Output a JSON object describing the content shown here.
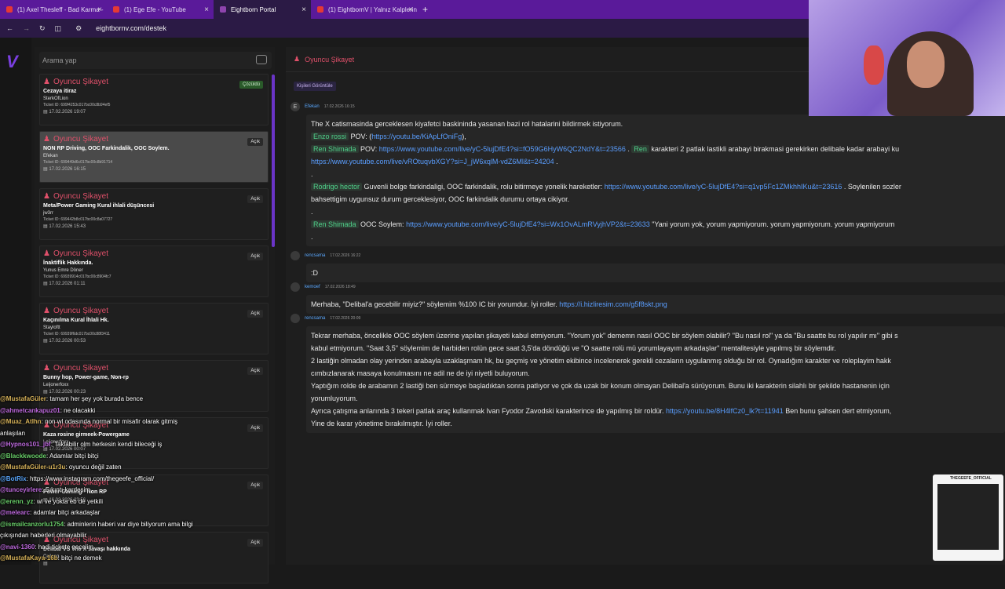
{
  "tabs": [
    {
      "label": "(1) Axel Thesleff - Bad Karma -",
      "color": "#e53935"
    },
    {
      "label": "(1) Ege Efe - YouTube",
      "color": "#e53935"
    },
    {
      "label": "Eightborn Portal",
      "color": "#8e44ad"
    },
    {
      "label": "(1) EightbornV | Yalnız Kalplerin",
      "color": "#e53935"
    }
  ],
  "newtab": "+",
  "url": "eightbornv.com/destek",
  "sidebar": {
    "search_placeholder": "Arama yap",
    "tickets": [
      {
        "title": "Oyuncu Şikayet",
        "subject": "Cezaya itiraz",
        "user": "SterkOfLion",
        "tid": "Ticket ID: 699f4253c017bc00c8b94ef5",
        "date": "17.02.2026 19:07",
        "status": "Çözüldü"
      },
      {
        "title": "Oyuncu Şikayet",
        "subject": "NON RP Driving, OOC Farkindalik, OOC Soylem.",
        "user": "Efekan",
        "tid": "Ticket ID: 699449d6c017bc00c8b91714",
        "date": "17.02.2026 16:15",
        "status": "Açık"
      },
      {
        "title": "Oyuncu Şikayet",
        "subject": "Meta/Power Gaming Kural ihlali düşüncesi",
        "user": "jw3rr",
        "tid": "Ticket ID: 699442b8c017bc00c8a07727",
        "date": "17.02.2026 15:43",
        "status": "Açık"
      },
      {
        "title": "Oyuncu Şikayet",
        "subject": "İnaktiflik Hakkında.",
        "user": "Yunus Emre Döner",
        "tid": "Ticket ID: 69939914c017bc00c8904fc7",
        "date": "17.02.2026 01:11",
        "status": "Açık"
      },
      {
        "title": "Oyuncu Şikayet",
        "subject": "Kaçınılma Kural İhlali Hk.",
        "user": "Stayloftt",
        "tid": "Ticket ID: 69939f6dc017bc00c88f3411",
        "date": "17.02.2026 00:53",
        "status": "Açık"
      },
      {
        "title": "Oyuncu Şikayet",
        "subject": "Bunny hop, Power-game, Non-rp",
        "user": "Leijonerfoxx",
        "tid": "",
        "date": "17.02.2026 00:23",
        "status": "Açık"
      },
      {
        "title": "Oyuncu Şikayet",
        "subject": "Kaza rosine girmeek-Powergame",
        "user": "Leijonerfoxx",
        "tid": "",
        "date": "17.02.2026 00:07",
        "status": "Açık"
      },
      {
        "title": "Oyuncu Şikayet",
        "subject": "Power-Gaming - Non RP",
        "user": "",
        "tid": "",
        "date": "16.02.2026 23:56",
        "status": "Açık"
      },
      {
        "title": "Oyuncu Şikayet",
        "subject": "Delibal VS The X savaşı hakkında",
        "user": "Ceileng",
        "tid": "",
        "date": "",
        "status": "Açık"
      }
    ]
  },
  "main": {
    "header": "Oyuncu Şikayet",
    "view_button": "Kişileri Görüntüle",
    "messages": [
      {
        "user": "Efekan",
        "date": "17.02.2026 16:15",
        "avatar": "E",
        "lines": [
          [
            {
              "t": "The X catismasinda gerceklesen kiyafetci baskininda yasanan bazi rol hatalarini bildirmek istiyorum."
            }
          ],
          [
            {
              "t": "Enzo rossi",
              "k": "tag"
            },
            {
              "t": " POV: ("
            },
            {
              "t": "https://youtu.be/KiApLfOniFg",
              "k": "link"
            },
            {
              "t": "),"
            }
          ],
          [
            {
              "t": "Ren Shimada",
              "k": "tag"
            },
            {
              "t": " POV: "
            },
            {
              "t": "https://www.youtube.com/live/yC-5lujDfE4?si=fO59G6HyW6QC2NdY&t=23566",
              "k": "link"
            },
            {
              "t": " . "
            },
            {
              "t": "Ren",
              "k": "tag"
            },
            {
              "t": " karakteri 2 patlak lastikli arabayi birakmasi gerekirken delibale kadar arabayi ku"
            }
          ],
          [
            {
              "t": "https://www.youtube.com/live/vROtuqvbXGY?si=J_jW6xqlM-vdZ6Ml&t=24204",
              "k": "link"
            },
            {
              "t": " ."
            }
          ],
          [
            {
              "t": "."
            }
          ],
          [
            {
              "t": "Rodrigo hector",
              "k": "tag"
            },
            {
              "t": " Guvenli bolge farkindaligi, OOC farkindalik, rolu bitirmeye yonelik hareketler: "
            },
            {
              "t": "https://www.youtube.com/live/yC-5lujDfE4?si=q1vp5Fc1ZMkhhIKu&t=23616",
              "k": "link"
            },
            {
              "t": " . Soylenilen sozler"
            }
          ],
          [
            {
              "t": "bahsettigim uygunsuz durum gerceklesiyor, OOC farkindalik durumu ortaya cikiyor."
            }
          ],
          [
            {
              "t": "."
            }
          ],
          [
            {
              "t": "Ren Shimada",
              "k": "tag"
            },
            {
              "t": " OOC Soylem: "
            },
            {
              "t": "https://www.youtube.com/live/yC-5lujDfE4?si=Wx1OvALmRVyjhVP2&t=23633",
              "k": "link"
            },
            {
              "t": " \"Yani yorum yok, yorum yapmiyorum. yorum yapmiyorum. yorum yapmiyorum"
            }
          ],
          [
            {
              "t": "."
            }
          ]
        ]
      },
      {
        "user": "rencsama",
        "date": "17.02.2026 16:22",
        "avatar": "",
        "lines": [
          [
            {
              "t": ":D"
            }
          ]
        ]
      },
      {
        "user": "kemoef",
        "date": "17.02.2026 18:49",
        "avatar": "",
        "lines": [
          [
            {
              "t": "Merhaba, \"Delibal'a gecebilir miyiz?\" söylemim %100 IC bir yorumdur. İyi roller. "
            },
            {
              "t": "https://i.hizliresim.com/g5f8skt.png",
              "k": "link"
            }
          ]
        ]
      },
      {
        "user": "rencsama",
        "date": "17.02.2026 20:09",
        "avatar": "",
        "lines": [
          [
            {
              "t": "Tekrar merhaba, öncelikle OOC söylem üzerine yapılan şikayeti kabul etmiyorum. \"Yorum yok\" dememn nasıl OOC bir söylem olabilir? \"Bu nasıl rol\" ya da \"Bu saatte bu rol yapılır mı\" gibi s"
            }
          ],
          [
            {
              "t": "kabul etmiyorum. \"Saat 3,5\" söylemim de harbiden rolün gece saat 3,5'da döndüğü ve \"O saatte rolü mü yorumlayayım arkadaşlar\" mentalitesiyle yapılmış bir söylemdir."
            }
          ],
          [
            {
              "t": "2 lastiğin olmadan olay yerinden arabayla uzaklaşmam hk, bu geçmiş ve yönetim ekibince incelenerek gerekli cezaların uygulanmış olduğu bir rol. Oynadığım karakter ve roleplayim hakk"
            }
          ],
          [
            {
              "t": "cımbızlanarak masaya konulmasını ne adil ne de iyi niyetli buluyorum."
            }
          ],
          [
            {
              "t": "Yaptığım rolde de arabamın 2 lastiği ben sürmeye başladıktan sonra patlıyor ve çok da uzak bir konum olmayan Delibal'a sürüyorum. Bunu iki karakterin silahlı bir şekilde hastanenin için"
            }
          ],
          [
            {
              "t": "yorumluyorum."
            }
          ],
          [
            {
              "t": "Ayrıca çatışma anlarında 3 tekeri patlak araç kullanmak Ivan Fyodor Zavodski karakterince de yapılmış bir roldür. "
            },
            {
              "t": "https://youtu.be/8H4lfCz0_lk?t=11941",
              "k": "link"
            },
            {
              "t": " Ben bunu şahsen dert etmiyorum,"
            }
          ],
          [
            {
              "t": "Yine de karar yönetime bırakılmıştır. İyi roller."
            }
          ]
        ]
      }
    ]
  },
  "chat": [
    {
      "n": "@MustafaGüler",
      "nc": "#d6b25a",
      "m": ": tamam her şey yok burada bence"
    },
    {
      "n": "@ahmetcankapuz01",
      "nc": "#c06be0",
      "m": ": ne olacakki"
    },
    {
      "n": "@Muaz_AtIhn",
      "nc": "#d6b25a",
      "m": ": non wl odasında normal bir misafir olarak gitmiş"
    },
    {
      "n": "",
      "nc": "#fff",
      "m": "anlaşılan"
    },
    {
      "n": "@Hypnos101_jbf",
      "nc": "#c06be0",
      "m": ": Taklabilir olm herkesin kendi bileceği iş"
    },
    {
      "n": "@Blackkwoode",
      "nc": "#6ad06a",
      "m": ": Adamlar bitçi bitçi"
    },
    {
      "n": "@MustafaGüler-u1r3u",
      "nc": "#d6b25a",
      "m": ": oyuncu değil zaten"
    },
    {
      "n": "@BotRix",
      "nc": "#5aa8ff",
      "m": ": https://www.instagram.com/thegeefe_official/"
    },
    {
      "n": "@tunceyirlere",
      "nc": "#c06be0",
      "m": ": Sıkıntı kardeşim"
    },
    {
      "n": "@erenn_yz",
      "nc": "#6ad06a",
      "m": ": wl ve yokta eb de yetkili"
    },
    {
      "n": "@melearc",
      "nc": "#c06be0",
      "m": ": adamlar bitçi arkadaşlar"
    },
    {
      "n": "@ismailcanzorlu1754",
      "nc": "#6ad06a",
      "m": ": adminlerin haberi var diye biliyorum ama bilgi"
    },
    {
      "n": "",
      "nc": "#fff",
      "m": "çıkışından haberleri olmayabilir"
    },
    {
      "n": "@navi-1360",
      "nc": "#c06be0",
      "m": ": hadi tickete geçelim"
    },
    {
      "n": "@MustafaKaya-16b",
      "nc": "#d6b25a",
      "m": ": bitçi ne demek"
    }
  ],
  "overlay": {
    "title": "THEGEEFE_OFFICIAL"
  }
}
